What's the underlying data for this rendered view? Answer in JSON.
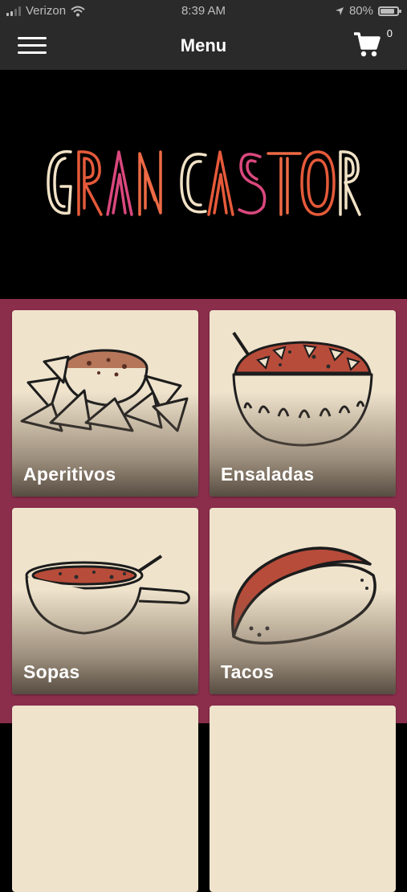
{
  "status_bar": {
    "carrier": "Verizon",
    "time": "8:39 AM",
    "battery": "80%"
  },
  "header": {
    "title": "Menu",
    "cart_count": "0"
  },
  "hero": {
    "logo_text": "GRAN CASTOR"
  },
  "categories": [
    {
      "label": "Aperitivos",
      "icon": "nachos-icon"
    },
    {
      "label": "Ensaladas",
      "icon": "salad-bowl-icon"
    },
    {
      "label": "Sopas",
      "icon": "soup-bowl-icon"
    },
    {
      "label": "Tacos",
      "icon": "taco-icon"
    }
  ],
  "colors": {
    "header_bg": "#2a2a2a",
    "grid_bg": "#8a2e4c",
    "card_bg": "#efe3cc",
    "logo_palette": [
      "#f1e2c6",
      "#e55a3a",
      "#d9487d",
      "#ee6a45"
    ]
  }
}
